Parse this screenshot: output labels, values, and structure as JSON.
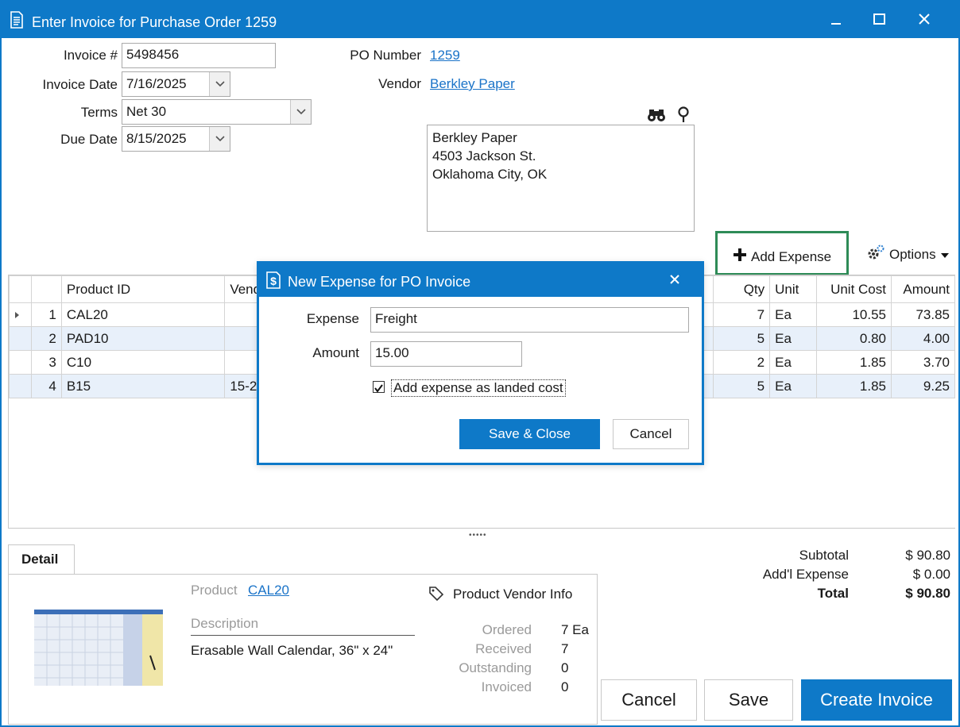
{
  "window": {
    "title": "Enter Invoice for Purchase Order 1259"
  },
  "form": {
    "invoice_label": "Invoice #",
    "invoice_value": "5498456",
    "invoice_date_label": "Invoice Date",
    "invoice_date_value": "7/16/2025",
    "terms_label": "Terms",
    "terms_value": "Net 30",
    "due_date_label": "Due Date",
    "due_date_value": "8/15/2025",
    "po_label": "PO Number",
    "po_value": "1259",
    "vendor_label": "Vendor",
    "vendor_value": "Berkley Paper",
    "address": [
      "Berkley Paper",
      "4503 Jackson St.",
      "Oklahoma City, OK"
    ]
  },
  "toolbar": {
    "add_expense": "Add Expense",
    "options": "Options"
  },
  "grid": {
    "headers": {
      "product_id": "Product ID",
      "vendor": "Vend",
      "qty": "Qty",
      "unit": "Unit",
      "unit_cost": "Unit Cost",
      "amount": "Amount"
    },
    "rows": [
      {
        "n": "1",
        "product": "CAL20",
        "vendor": "",
        "qty": "7",
        "unit": "Ea",
        "unit_cost": "10.55",
        "amount": "73.85"
      },
      {
        "n": "2",
        "product": "PAD10",
        "vendor": "",
        "qty": "5",
        "unit": "Ea",
        "unit_cost": "0.80",
        "amount": "4.00"
      },
      {
        "n": "3",
        "product": "C10",
        "vendor": "",
        "qty": "2",
        "unit": "Ea",
        "unit_cost": "1.85",
        "amount": "3.70"
      },
      {
        "n": "4",
        "product": "B15",
        "vendor": "15-2",
        "qty": "5",
        "unit": "Ea",
        "unit_cost": "1.85",
        "amount": "9.25"
      }
    ]
  },
  "splitter": "•••••",
  "detail": {
    "tab": "Detail",
    "product_label": "Product",
    "product_value": "CAL20",
    "description_label": "Description",
    "description_value": "Erasable Wall Calendar, 36\" x 24\"",
    "pvi_title": "Product Vendor Info",
    "ordered_label": "Ordered",
    "ordered_value": "7 Ea",
    "received_label": "Received",
    "received_value": "7",
    "outstanding_label": "Outstanding",
    "outstanding_value": "0",
    "invoiced_label": "Invoiced",
    "invoiced_value": "0"
  },
  "totals": {
    "subtotal_label": "Subtotal",
    "subtotal_value": "$ 90.80",
    "addl_label": "Add'l Expense",
    "addl_value": "$ 0.00",
    "total_label": "Total",
    "total_value": "$ 90.80"
  },
  "buttons": {
    "cancel": "Cancel",
    "save": "Save",
    "create": "Create Invoice"
  },
  "dialog": {
    "title": "New Expense for PO Invoice",
    "expense_label": "Expense",
    "expense_value": "Freight",
    "amount_label": "Amount",
    "amount_value": "15.00",
    "landed_label": "Add expense as landed cost",
    "landed_checked": true,
    "save_close": "Save & Close",
    "cancel": "Cancel"
  },
  "colors": {
    "accent": "#0e79c8",
    "highlight_border": "#2e8b57",
    "link": "#1a73c8",
    "alt_row": "#e8f0fa"
  }
}
